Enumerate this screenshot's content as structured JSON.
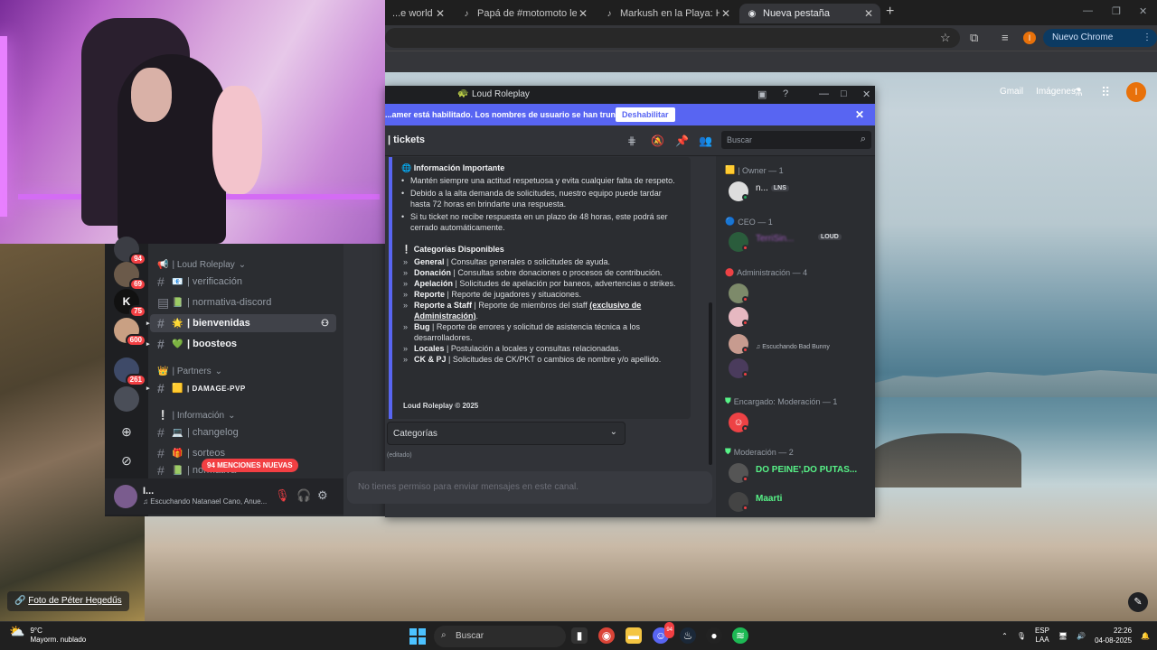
{
  "browser": {
    "tabs": [
      {
        "label": "...e world",
        "icon": "globe-icon"
      },
      {
        "label": "Papá de #motomoto le prepara...",
        "icon": "tiktok-icon"
      },
      {
        "label": "Markush en la Playa: Humor y ...",
        "icon": "tiktok-icon"
      },
      {
        "label": "Nueva pestaña",
        "icon": "chrome-icon"
      }
    ],
    "update_button": "Nuevo Chrome disponible",
    "profile_initial": "I"
  },
  "google": {
    "links": [
      "Gmail",
      "Imágenes"
    ],
    "avatar_initial": "I",
    "photo_credit": "Foto de Péter Hegedűs"
  },
  "discord_main": {
    "server_badges": [
      "94",
      "69",
      "75",
      "600",
      "261"
    ],
    "categories": {
      "server": "| Loud Roleplay",
      "partners": "| Partners",
      "informacion": "| Información"
    },
    "channels": [
      {
        "name": "| verificación",
        "emoji": "📧"
      },
      {
        "name": "| normativa-discord",
        "emoji": "📗"
      },
      {
        "name": "| bienvenidas",
        "emoji": "🌟"
      },
      {
        "name": "| boosteos",
        "emoji": "💚"
      },
      {
        "name": "| DAMAGE-PVP",
        "emoji": "🟨"
      },
      {
        "name": "| changelog",
        "emoji": "💻"
      },
      {
        "name": "| sorteos",
        "emoji": "🎁"
      },
      {
        "name": "| normativa",
        "emoji": "📗"
      }
    ],
    "mentions": "94 MENCIONES NUEVAS",
    "user": {
      "name": "I...",
      "status": "Escuchando Natanael Cano, Anue..."
    }
  },
  "discord_window": {
    "title": "Loud Roleplay",
    "banner": "...amer está habilitado. Los nombres de usuario se han truncado.",
    "disable_button": "Deshabilitar",
    "channel": "| tickets",
    "search_placeholder": "Buscar",
    "embed": {
      "info_heading": "Información Importante",
      "info_items": [
        "Mantén siempre una actitud respetuosa y evita cualquier falta de respeto.",
        "Debido a la alta demanda de solicitudes, nuestro equipo puede tardar hasta 72 horas en brindarte una respuesta.",
        "Si tu ticket no recibe respuesta en un plazo de 48 horas, este podrá ser cerrado automáticamente."
      ],
      "cat_heading": "Categorías Disponibles",
      "categories": [
        {
          "name": "General",
          "desc": " | Consultas generales o solicitudes de ayuda."
        },
        {
          "name": "Donación",
          "desc": " | Consultas sobre donaciones o procesos de contribución."
        },
        {
          "name": "Apelación",
          "desc": " | Solicitudes de apelación por baneos, advertencias o strikes."
        },
        {
          "name": "Reporte",
          "desc": " | Reporte de jugadores y situaciones."
        },
        {
          "name": "Reporte a Staff",
          "desc": " | Reporte de miembros del staff ",
          "extra": "(exclusivo de Administración)",
          "tail": "."
        },
        {
          "name": "Bug",
          "desc": " | Reporte de errores y solicitud de asistencia técnica a los desarrolladores."
        },
        {
          "name": "Locales",
          "desc": " | Postulación a locales y consultas relacionadas."
        },
        {
          "name": "CK & PJ",
          "desc": " | Solicitudes de CK/PKT o cambios de nombre y/o apellido."
        }
      ],
      "footer": "Loud Roleplay © 2025"
    },
    "select_placeholder": "Categorías",
    "edited": "(editado)",
    "input_placeholder": "No tienes permiso para enviar mensajes en este canal.",
    "members": {
      "groups": [
        {
          "label": "| Owner — 1"
        },
        {
          "label": "CEO — 1"
        },
        {
          "label": "Administración — 4"
        },
        {
          "label": "Encargado: Moderación — 1"
        },
        {
          "label": "Moderación — 2"
        }
      ],
      "owner": {
        "name": "n...",
        "tag": "LNS"
      },
      "ceo": {
        "name": "TerriSin...",
        "tag": "LOUD"
      },
      "admin_status": "Escuchando Bad Bunny",
      "mod1": "DO PEINE',DO PUTAS...",
      "mod2": "Maarti"
    }
  },
  "taskbar": {
    "weather_temp": "9°C",
    "weather_desc": "Mayorm. nublado",
    "search": "Buscar",
    "lang1": "ESP",
    "lang2": "LAA",
    "time": "22:26",
    "date": "04-08-2025",
    "discord_badge": "94"
  },
  "colors": {
    "discord_blurple": "#5865f2",
    "mention_red": "#f23f43",
    "mod_green": "#57f287",
    "admin_red": "#ed4245"
  }
}
